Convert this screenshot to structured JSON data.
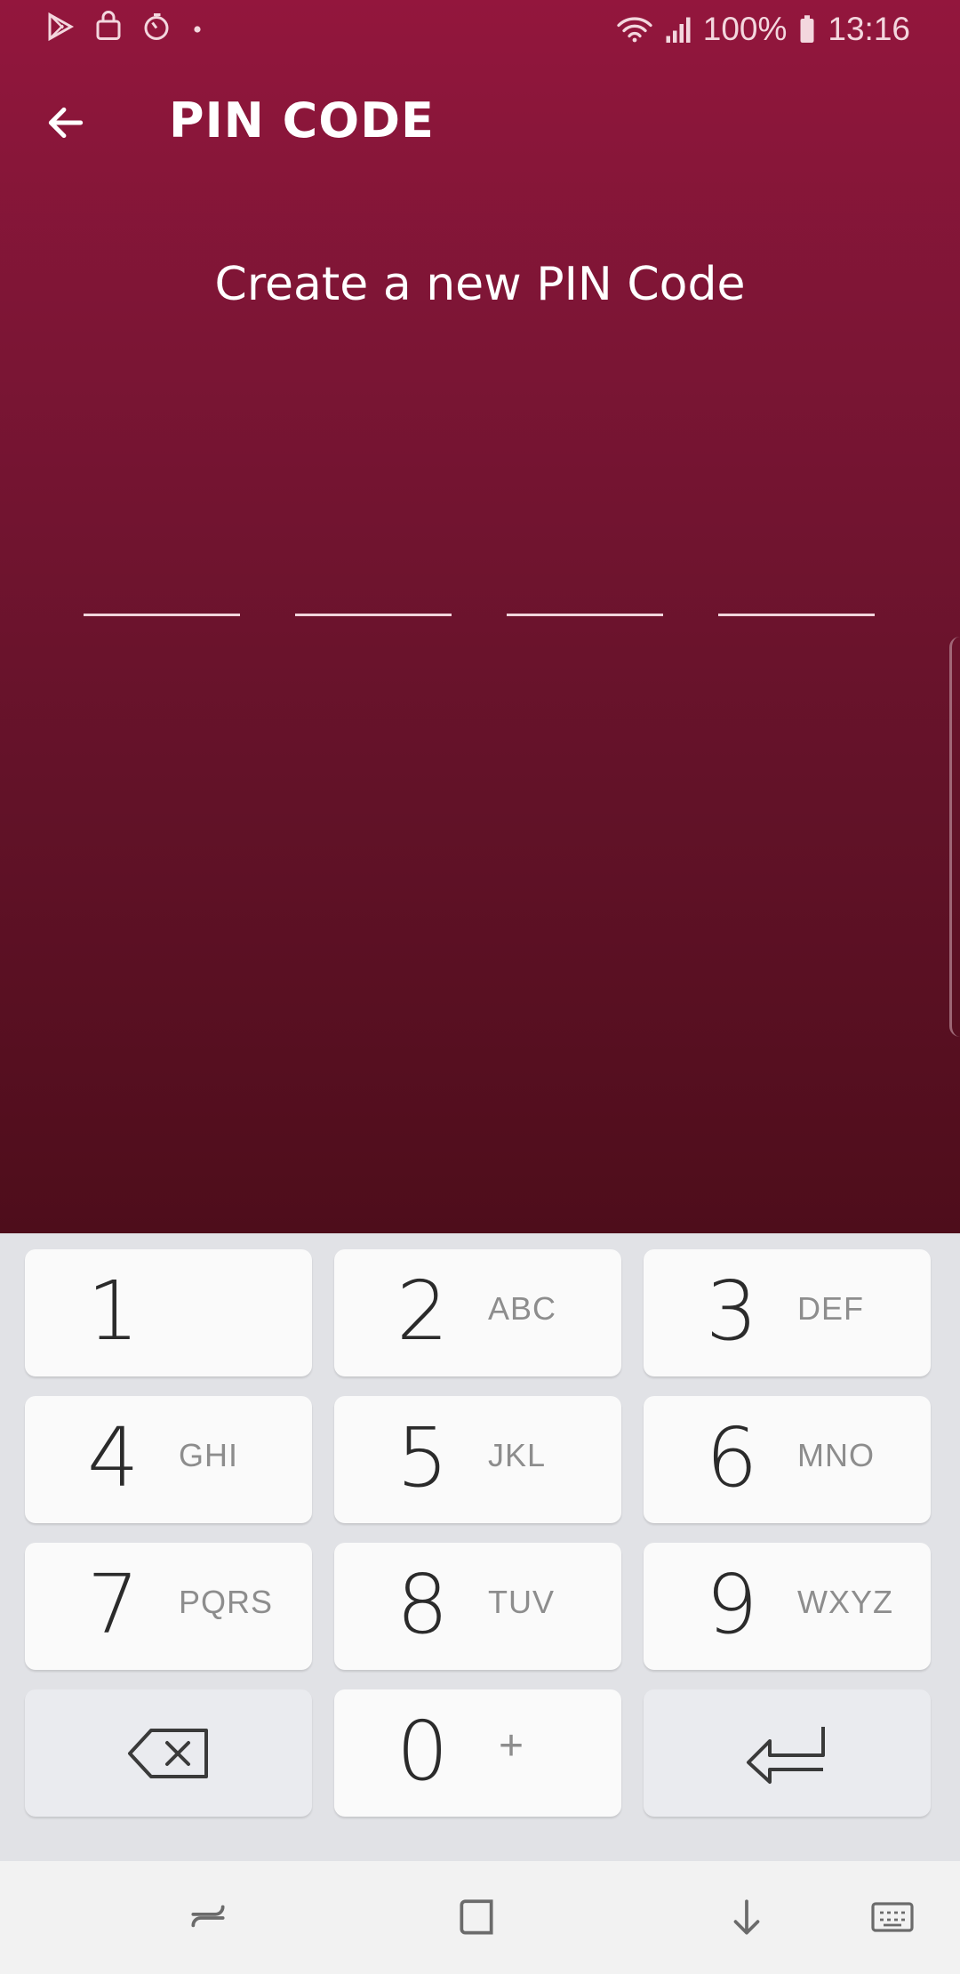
{
  "status_bar": {
    "battery": "100%",
    "time": "13:16",
    "icons": [
      "play-store-icon",
      "shopping-bag-icon",
      "timer-icon",
      "dot-icon",
      "wifi-icon",
      "signal-icon",
      "battery-icon"
    ]
  },
  "toolbar": {
    "title": "PIN CODE",
    "back_icon": "arrow-left-icon"
  },
  "prompt": "Create a new PIN Code",
  "pin": {
    "length": 4,
    "entered": 0
  },
  "keypad": {
    "keys": [
      {
        "digit": "1",
        "letters": ""
      },
      {
        "digit": "2",
        "letters": "ABC"
      },
      {
        "digit": "3",
        "letters": "DEF"
      },
      {
        "digit": "4",
        "letters": "GHI"
      },
      {
        "digit": "5",
        "letters": "JKL"
      },
      {
        "digit": "6",
        "letters": "MNO"
      },
      {
        "digit": "7",
        "letters": "PQRS"
      },
      {
        "digit": "8",
        "letters": "TUV"
      },
      {
        "digit": "9",
        "letters": "WXYZ"
      },
      {
        "digit": "0",
        "letters": "+"
      }
    ],
    "backspace_icon": "backspace-icon",
    "enter_icon": "enter-icon"
  },
  "navbar": {
    "icons": [
      "recent-apps-icon",
      "home-icon",
      "hide-keyboard-icon",
      "keyboard-icon"
    ]
  },
  "colors": {
    "header_top": "#93163d",
    "header_bottom": "#4e0d1b",
    "keypad_bg": "#e1e2e6",
    "key_bg": "#fafafa"
  }
}
